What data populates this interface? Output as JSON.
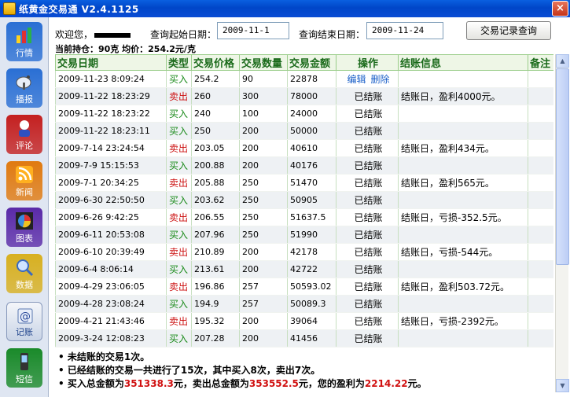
{
  "window": {
    "title": "纸黄金交易通 V2.4.1125",
    "close_glyph": "×"
  },
  "sidebar": {
    "items": [
      {
        "label": "行情",
        "icon": "bar-chart-icon",
        "color": "#2a6fd4"
      },
      {
        "label": "播报",
        "icon": "satellite-dish-icon",
        "color": "#2a6fd4"
      },
      {
        "label": "评论",
        "icon": "person-icon",
        "color": "#c42020"
      },
      {
        "label": "新闻",
        "icon": "rss-icon",
        "color": "#e07a10"
      },
      {
        "label": "图表",
        "icon": "pie-chart-icon",
        "color": "#5a2aa8"
      },
      {
        "label": "数据",
        "icon": "magnifier-icon",
        "color": "#d8b020"
      },
      {
        "label": "记账",
        "icon": "email-ledger-icon",
        "color": "#c9d4e6",
        "active": true
      },
      {
        "label": "短信",
        "icon": "mobile-phone-icon",
        "color": "#1a8a2a"
      }
    ]
  },
  "header": {
    "welcome": "欢迎您，",
    "start_label": "查询起始日期：",
    "start_date": "2009-11-1",
    "end_label": "查询结束日期：",
    "end_date": "2009-11-24",
    "query_button": "交易记录查询",
    "holding": "当前持仓：90克  均价：254.2元/克"
  },
  "table": {
    "columns": [
      "交易日期",
      "类型",
      "交易价格",
      "交易数量",
      "交易金额",
      "操作",
      "结账信息",
      "备注"
    ],
    "edit_label": "编辑",
    "delete_label": "删除",
    "rows": [
      {
        "date": "2009-11-23 8:09:24",
        "type": "买入",
        "price": "254.2",
        "qty": "90",
        "amount": "22878",
        "op": "",
        "info": "",
        "note": ""
      },
      {
        "date": "2009-11-22 18:23:29",
        "type": "卖出",
        "price": "260",
        "qty": "300",
        "amount": "78000",
        "op": "已结账",
        "info": "结账日，盈利4000元。",
        "note": ""
      },
      {
        "date": "2009-11-22 18:23:22",
        "type": "买入",
        "price": "240",
        "qty": "100",
        "amount": "24000",
        "op": "已结账",
        "info": "",
        "note": ""
      },
      {
        "date": "2009-11-22 18:23:11",
        "type": "买入",
        "price": "250",
        "qty": "200",
        "amount": "50000",
        "op": "已结账",
        "info": "",
        "note": ""
      },
      {
        "date": "2009-7-14 23:24:54",
        "type": "卖出",
        "price": "203.05",
        "qty": "200",
        "amount": "40610",
        "op": "已结账",
        "info": "结账日，盈利434元。",
        "note": ""
      },
      {
        "date": "2009-7-9 15:15:53",
        "type": "买入",
        "price": "200.88",
        "qty": "200",
        "amount": "40176",
        "op": "已结账",
        "info": "",
        "note": ""
      },
      {
        "date": "2009-7-1 20:34:25",
        "type": "卖出",
        "price": "205.88",
        "qty": "250",
        "amount": "51470",
        "op": "已结账",
        "info": "结账日，盈利565元。",
        "note": ""
      },
      {
        "date": "2009-6-30 22:50:50",
        "type": "买入",
        "price": "203.62",
        "qty": "250",
        "amount": "50905",
        "op": "已结账",
        "info": "",
        "note": ""
      },
      {
        "date": "2009-6-26 9:42:25",
        "type": "卖出",
        "price": "206.55",
        "qty": "250",
        "amount": "51637.5",
        "op": "已结账",
        "info": "结账日，亏损-352.5元。",
        "note": ""
      },
      {
        "date": "2009-6-11 20:53:08",
        "type": "买入",
        "price": "207.96",
        "qty": "250",
        "amount": "51990",
        "op": "已结账",
        "info": "",
        "note": ""
      },
      {
        "date": "2009-6-10 20:39:49",
        "type": "卖出",
        "price": "210.89",
        "qty": "200",
        "amount": "42178",
        "op": "已结账",
        "info": "结账日，亏损-544元。",
        "note": ""
      },
      {
        "date": "2009-6-4 8:06:14",
        "type": "买入",
        "price": "213.61",
        "qty": "200",
        "amount": "42722",
        "op": "已结账",
        "info": "",
        "note": ""
      },
      {
        "date": "2009-4-29 23:06:05",
        "type": "卖出",
        "price": "196.86",
        "qty": "257",
        "amount": "50593.02",
        "op": "已结账",
        "info": "结账日，盈利503.72元。",
        "note": ""
      },
      {
        "date": "2009-4-28 23:08:24",
        "type": "买入",
        "price": "194.9",
        "qty": "257",
        "amount": "50089.3",
        "op": "已结账",
        "info": "",
        "note": ""
      },
      {
        "date": "2009-4-21 21:43:46",
        "type": "卖出",
        "price": "195.32",
        "qty": "200",
        "amount": "39064",
        "op": "已结账",
        "info": "结账日，亏损-2392元。",
        "note": ""
      },
      {
        "date": "2009-3-24 12:08:23",
        "type": "买入",
        "price": "207.28",
        "qty": "200",
        "amount": "41456",
        "op": "已结账",
        "info": "",
        "note": ""
      }
    ]
  },
  "summary": {
    "line1": "• 未结账的交易1次。",
    "line2": "• 已经结账的交易一共进行了15次，其中买入8次，卖出7次。",
    "line3_a": "• 买入总金额为",
    "buy_total": "351338.3",
    "line3_b": "元，卖出总金额为",
    "sell_total": "353552.5",
    "line3_c": "元，您的盈利为",
    "profit": "2214.22",
    "line3_d": "元。"
  },
  "scrollbar": {
    "up_glyph": "▲",
    "down_glyph": "▼"
  },
  "colors": {
    "buy": "#1a8a1a",
    "sell": "#cc1010",
    "header_green": "#1a6a1a",
    "accent_red": "#d01010"
  }
}
